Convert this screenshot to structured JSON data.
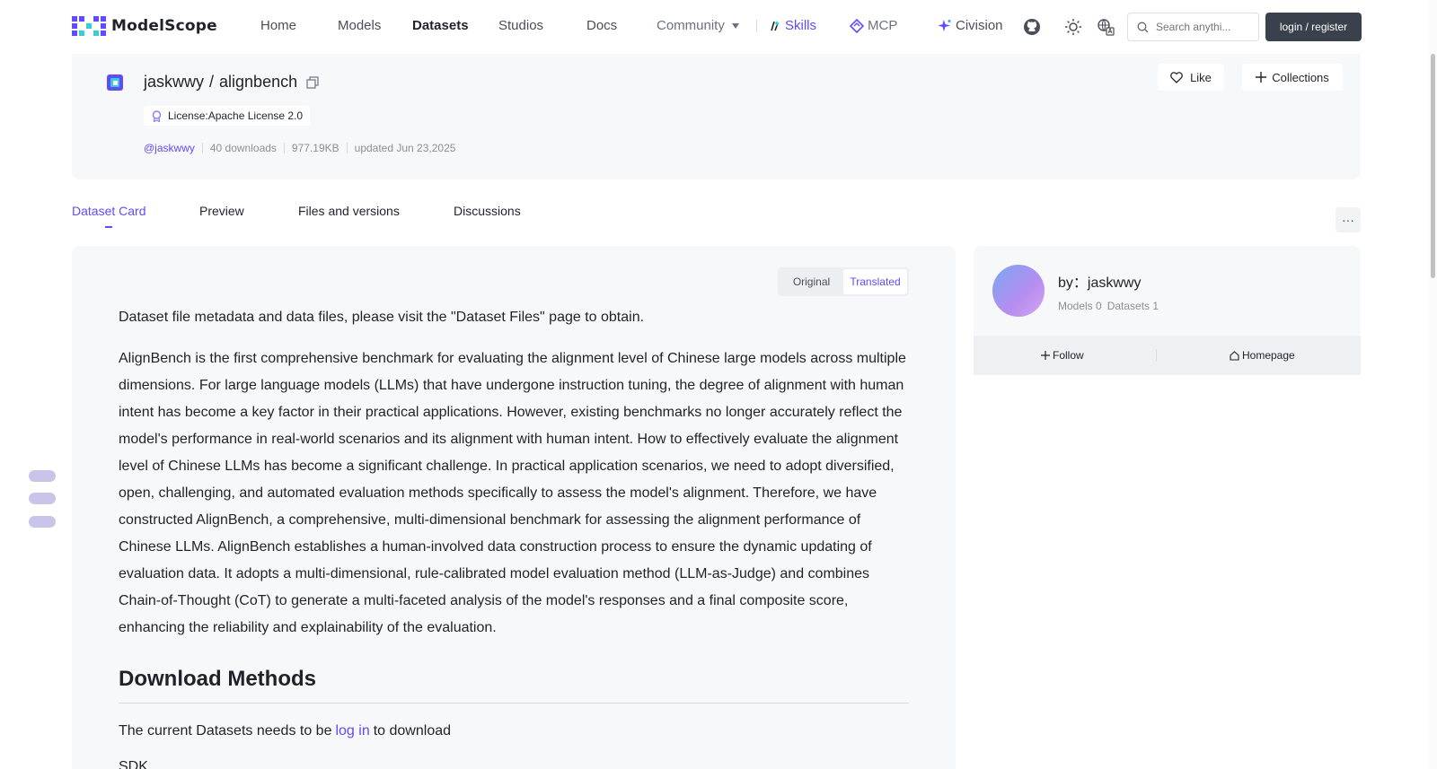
{
  "nav": {
    "brand": "ModelScope",
    "items": [
      {
        "label": "Home"
      },
      {
        "label": "Models"
      },
      {
        "label": "Datasets"
      },
      {
        "label": "Studios"
      },
      {
        "label": "Docs"
      },
      {
        "label": "Community"
      }
    ],
    "skills": "Skills",
    "mcp": "MCP",
    "civision": "Civision",
    "search_placeholder": "Search anythi...",
    "login": "login / register"
  },
  "dataset": {
    "owner": "jaskwwy",
    "slash": "/",
    "name": "alignbench",
    "license": "License:Apache License 2.0",
    "author_handle": "@jaskwwy",
    "downloads": "40 downloads",
    "size": "977.19KB",
    "updated": "updated Jun 23,2025",
    "like": "Like",
    "collections": "Collections"
  },
  "tabs": [
    {
      "label": "Dataset Card"
    },
    {
      "label": "Preview"
    },
    {
      "label": "Files and versions"
    },
    {
      "label": "Discussions"
    }
  ],
  "more": "···",
  "toggle": {
    "original": "Original",
    "translated": "Translated"
  },
  "content": {
    "intro": "Dataset file metadata and data files, please visit the \"Dataset Files\" page to obtain.",
    "body": "AlignBench is the first comprehensive benchmark for evaluating the alignment level of Chinese large models across multiple dimensions. For large language models (LLMs) that have undergone instruction tuning, the degree of alignment with human intent has become a key factor in their practical applications. However, existing benchmarks no longer accurately reflect the model's performance in real-world scenarios and its alignment with human intent. How to effectively evaluate the alignment level of Chinese LLMs has become a significant challenge. In practical application scenarios, we need to adopt diversified, open, challenging, and automated evaluation methods specifically to assess the model's alignment. Therefore, we have constructed AlignBench, a comprehensive, multi-dimensional benchmark for assessing the alignment performance of Chinese LLMs. AlignBench establishes a human-involved data construction process to ensure the dynamic updating of evaluation data. It adopts a multi-dimensional, rule-calibrated model evaluation method (LLM-as-Judge) and combines Chain-of-Thought (CoT) to generate a multi-faceted analysis of the model's responses and a final composite score, enhancing the reliability and explainability of the evaluation.",
    "download_heading": "Download Methods",
    "login_prefix": "The current Datasets needs to be",
    "login_link": "log in",
    "login_suffix": "to download",
    "sdk": "SDK"
  },
  "author_card": {
    "by": "by：jaskwwy",
    "models": "Models 0",
    "datasets": "Datasets 1",
    "follow": "Follow",
    "homepage": "Homepage"
  },
  "colors": {
    "accent": "#624aff",
    "login_bg": "#3b414c",
    "card_bg": "#f7f8fa"
  }
}
